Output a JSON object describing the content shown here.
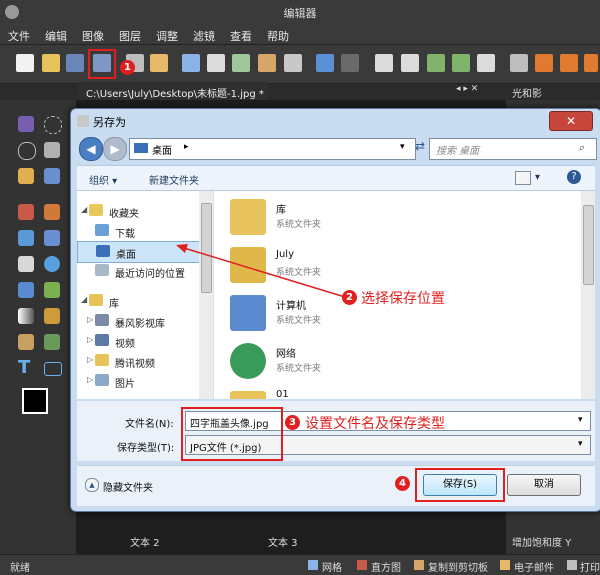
{
  "app": {
    "title": "编辑器"
  },
  "menu": [
    "文件",
    "编辑",
    "图像",
    "图层",
    "调整",
    "滤镜",
    "查看",
    "帮助"
  ],
  "document_tab": "C:\\Users\\July\\Desktop\\未标题-1.jpg *",
  "right_panel_tab": "光和影",
  "right_panel_caption": "增加饱和度 Y",
  "canvas_captions": [
    "文本 2",
    "文本 3"
  ],
  "status": {
    "ready": "就绪",
    "grid": "网格",
    "histogram": "直方图",
    "copy_clipboard": "复制到剪切板",
    "email": "电子邮件",
    "print": "打印"
  },
  "dialog": {
    "title": "另存为",
    "address": "桌面",
    "search_placeholder": "搜索 桌面",
    "organize": "组织 ▾",
    "new_folder": "新建文件夹",
    "nav": [
      {
        "label": "收藏夹",
        "type": "group"
      },
      {
        "label": "下载",
        "type": "item"
      },
      {
        "label": "桌面",
        "type": "item",
        "selected": true
      },
      {
        "label": "最近访问的位置",
        "type": "item"
      },
      {
        "label": "库",
        "type": "group"
      },
      {
        "label": "暴风影视库",
        "type": "item"
      },
      {
        "label": "视频",
        "type": "item"
      },
      {
        "label": "腾讯视频",
        "type": "item"
      },
      {
        "label": "图片",
        "type": "item"
      }
    ],
    "files": [
      {
        "name": "库",
        "type": "系统文件夹"
      },
      {
        "name": "July",
        "type": "系统文件夹"
      },
      {
        "name": "计算机",
        "type": "系统文件夹"
      },
      {
        "name": "网络",
        "type": "系统文件夹"
      },
      {
        "name": "01",
        "type": ""
      }
    ],
    "filename_label": "文件名(N):",
    "filename_value": "四字瓶盖头像.jpg",
    "filetype_label": "保存类型(T):",
    "filetype_value": "JPG文件 (*.jpg)",
    "hide_folders": "隐藏文件夹",
    "save": "保存(S)",
    "cancel": "取消",
    "close": "✕"
  },
  "annotations": [
    {
      "num": "1",
      "text": ""
    },
    {
      "num": "2",
      "text": "选择保存位置"
    },
    {
      "num": "3",
      "text": "设置文件名及保存类型"
    },
    {
      "num": "4",
      "text": ""
    }
  ],
  "colors": {
    "annotation": "#e02020",
    "dialog_bg": "#c9dcf0",
    "app_bg": "#2b2b2b"
  }
}
